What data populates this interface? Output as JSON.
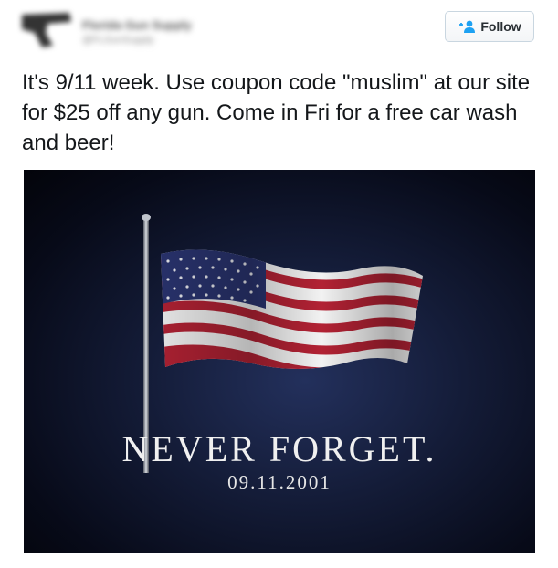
{
  "header": {
    "user_name": "Florida Gun Supply",
    "user_handle": "@FLGunSupply",
    "follow_label": "Follow"
  },
  "tweet": {
    "text": "It's 9/11 week. Use coupon code \"muslim\" at our site for $25 off any gun. Come in Fri for a free car wash and beer!"
  },
  "media": {
    "headline": "NEVER FORGET.",
    "date": "09.11.2001"
  },
  "colors": {
    "follow_accent": "#1da1f2",
    "flag_red": "#b22234",
    "flag_blue": "#2a3470"
  },
  "icons": {
    "follow": "person-add-icon",
    "avatar": "gun-silhouette-icon"
  }
}
